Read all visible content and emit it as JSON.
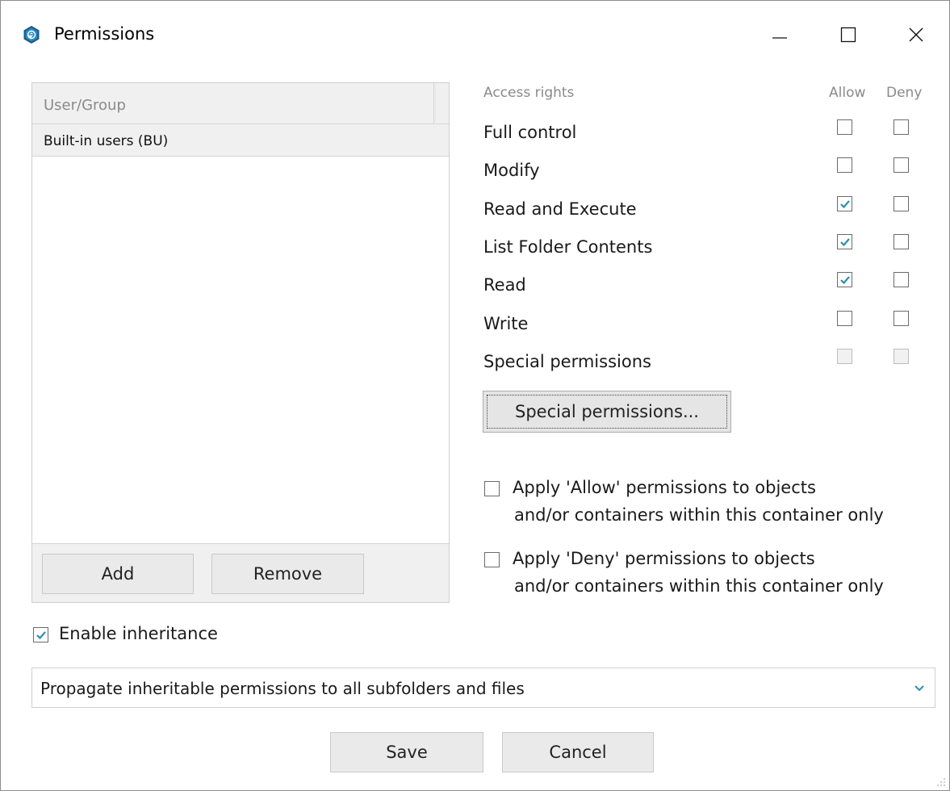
{
  "window": {
    "title": "Permissions",
    "controls": {
      "minimize_icon": "minimize-icon",
      "maximize_icon": "maximize-icon",
      "close_icon": "close-icon"
    }
  },
  "user_list": {
    "header": "User/Group",
    "items": [
      {
        "label": "Built-in users (BU)"
      }
    ],
    "add_label": "Add",
    "remove_label": "Remove"
  },
  "access": {
    "header_label": "Access rights",
    "allow_header": "Allow",
    "deny_header": "Deny",
    "rows": [
      {
        "label": "Full control",
        "allow": false,
        "deny": false,
        "disabled": false
      },
      {
        "label": "Modify",
        "allow": false,
        "deny": false,
        "disabled": false
      },
      {
        "label": "Read and Execute",
        "allow": true,
        "deny": false,
        "disabled": false
      },
      {
        "label": "List Folder Contents",
        "allow": true,
        "deny": false,
        "disabled": false
      },
      {
        "label": "Read",
        "allow": true,
        "deny": false,
        "disabled": false
      },
      {
        "label": "Write",
        "allow": false,
        "deny": false,
        "disabled": false
      },
      {
        "label": "Special permissions",
        "allow": false,
        "deny": false,
        "disabled": true
      }
    ],
    "special_button_label": "Special permissions..."
  },
  "apply_options": {
    "allow": {
      "line1": "Apply 'Allow' permissions to objects",
      "line2": "and/or containers within this container only",
      "checked": false
    },
    "deny": {
      "line1": "Apply 'Deny' permissions to objects",
      "line2": "and/or containers within this container only",
      "checked": false
    }
  },
  "inheritance": {
    "label": "Enable inheritance",
    "checked": true
  },
  "propagation": {
    "selected": "Propagate inheritable permissions to all subfolders and files"
  },
  "footer": {
    "save_label": "Save",
    "cancel_label": "Cancel"
  },
  "colors": {
    "accent": "#1e88a8",
    "checkmark": "#2b8fb0"
  }
}
